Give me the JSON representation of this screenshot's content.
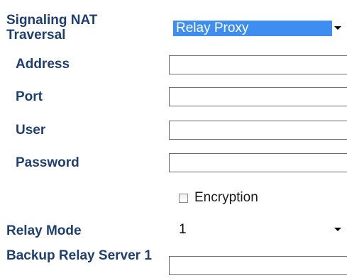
{
  "form": {
    "signaling_nat_traversal": {
      "label": "Signaling NAT Traversal",
      "selected": "Relay Proxy"
    },
    "address": {
      "label": "Address",
      "value": ""
    },
    "port": {
      "label": "Port",
      "value": ""
    },
    "user": {
      "label": "User",
      "value": ""
    },
    "password": {
      "label": "Password",
      "value": ""
    },
    "encryption": {
      "label": "Encryption",
      "checked": false
    },
    "relay_mode": {
      "label": "Relay Mode",
      "selected": "1"
    },
    "backup_relay_server_1": {
      "label": "Backup Relay Server 1",
      "value": ""
    }
  },
  "icons": {
    "dropdown": "chevron-down-icon"
  }
}
